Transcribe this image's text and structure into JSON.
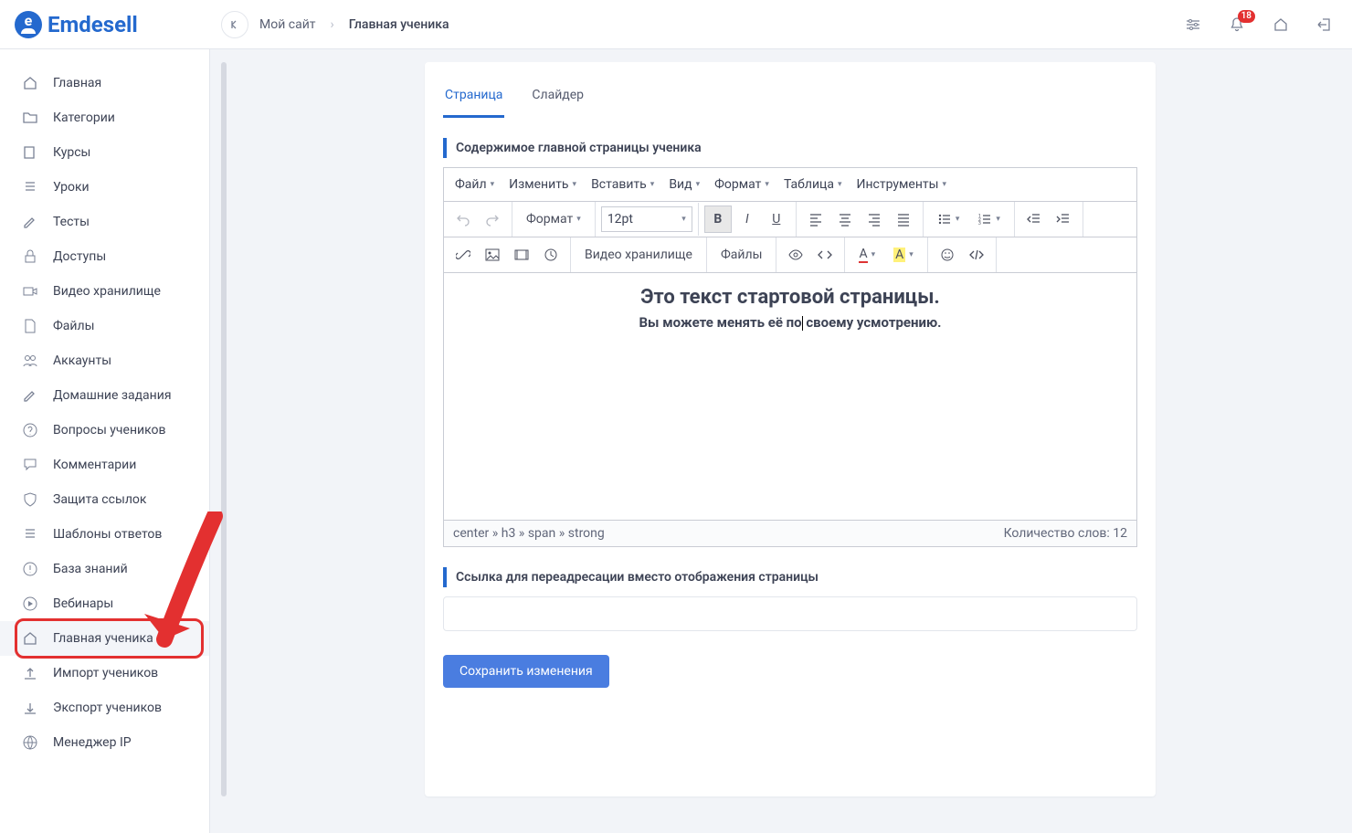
{
  "brand": "Emdesell",
  "breadcrumbs": {
    "site": "Мой сайт",
    "page": "Главная ученика"
  },
  "notifications_count": "18",
  "sidebar": {
    "items": [
      {
        "label": "Главная",
        "icon": "home-icon"
      },
      {
        "label": "Категории",
        "icon": "folder-icon"
      },
      {
        "label": "Курсы",
        "icon": "book-icon"
      },
      {
        "label": "Уроки",
        "icon": "list-icon"
      },
      {
        "label": "Тесты",
        "icon": "edit-icon"
      },
      {
        "label": "Доступы",
        "icon": "lock-icon"
      },
      {
        "label": "Видео хранилище",
        "icon": "video-icon"
      },
      {
        "label": "Файлы",
        "icon": "file-icon"
      },
      {
        "label": "Аккаунты",
        "icon": "users-icon"
      },
      {
        "label": "Домашние задания",
        "icon": "pencil-icon"
      },
      {
        "label": "Вопросы учеников",
        "icon": "question-icon"
      },
      {
        "label": "Комментарии",
        "icon": "comment-icon"
      },
      {
        "label": "Защита ссылок",
        "icon": "shield-icon"
      },
      {
        "label": "Шаблоны ответов",
        "icon": "template-icon"
      },
      {
        "label": "База знаний",
        "icon": "kb-icon"
      },
      {
        "label": "Вебинары",
        "icon": "play-icon"
      },
      {
        "label": "Главная ученика",
        "icon": "home-alt-icon",
        "active": true
      },
      {
        "label": "Импорт учеников",
        "icon": "upload-icon"
      },
      {
        "label": "Экспорт учеников",
        "icon": "download-icon"
      },
      {
        "label": "Менеджер IP",
        "icon": "ip-icon"
      }
    ]
  },
  "tabs": [
    {
      "label": "Страница",
      "active": true
    },
    {
      "label": "Слайдер",
      "active": false
    }
  ],
  "sections": {
    "content_title": "Содержимое главной страницы ученика",
    "redirect_title": "Ссылка для переадресации вместо отображения страницы"
  },
  "editor": {
    "menus": [
      "Файл",
      "Изменить",
      "Вставить",
      "Вид",
      "Формат",
      "Таблица",
      "Инструменты"
    ],
    "format_label": "Формат",
    "fontsize": "12pt",
    "video_storage_btn": "Видео хранилище",
    "files_btn": "Файлы",
    "content_heading": "Это текст стартовой страницы.",
    "content_sub_before": "Вы можете менять её по",
    "content_sub_after": " своему усмотрению.",
    "status_path": "center » h3 » span » strong",
    "wordcount": "Количество слов: 12"
  },
  "redirect_value": "",
  "save_button": "Сохранить изменения"
}
